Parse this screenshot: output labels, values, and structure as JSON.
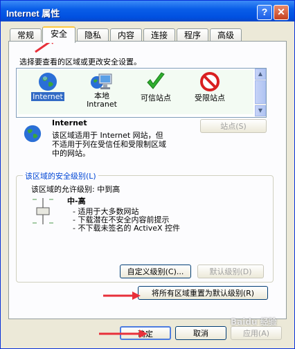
{
  "window": {
    "title": "Internet 属性",
    "help": "?",
    "close": "✕"
  },
  "tabs": [
    {
      "label": "常规"
    },
    {
      "label": "安全"
    },
    {
      "label": "隐私"
    },
    {
      "label": "内容"
    },
    {
      "label": "连接"
    },
    {
      "label": "程序"
    },
    {
      "label": "高级"
    }
  ],
  "security": {
    "instruction": "选择要查看的区域或更改安全设置。",
    "zones": [
      {
        "label": "Internet",
        "icon": "globe-icon"
      },
      {
        "label": "本地\nIntranet",
        "icon": "intranet-icon"
      },
      {
        "label": "可信站点",
        "icon": "check-icon"
      },
      {
        "label": "受限站点",
        "icon": "restricted-icon"
      }
    ],
    "selected_zone": "Internet",
    "zone_title": "Internet",
    "zone_desc": "该区域适用于 Internet 网站，但\n不适用于列在受信任和受限制区域\n中的网站。",
    "sites_button": "站点(S)",
    "level_group_title": "该区域的安全级别(L)",
    "allowed_level": "该区域的允许级别: 中到高",
    "level_name": "中-高",
    "level_items": [
      "- 适用于大多数网站",
      "- 下载潜在不安全内容前提示",
      "- 不下载未签名的 ActiveX 控件"
    ],
    "custom_button": "自定义级别(C)...",
    "default_button": "默认级别(D)",
    "reset_all_button": "将所有区域重置为默认级别(R)"
  },
  "footer": {
    "ok": "确定",
    "cancel": "取消",
    "apply": "应用(A)"
  },
  "watermark": "Baidu 经验",
  "colors": {
    "title_bar": "#0a5ee8",
    "selection": "#316ac5",
    "annotation_arrow": "#e8303a"
  }
}
